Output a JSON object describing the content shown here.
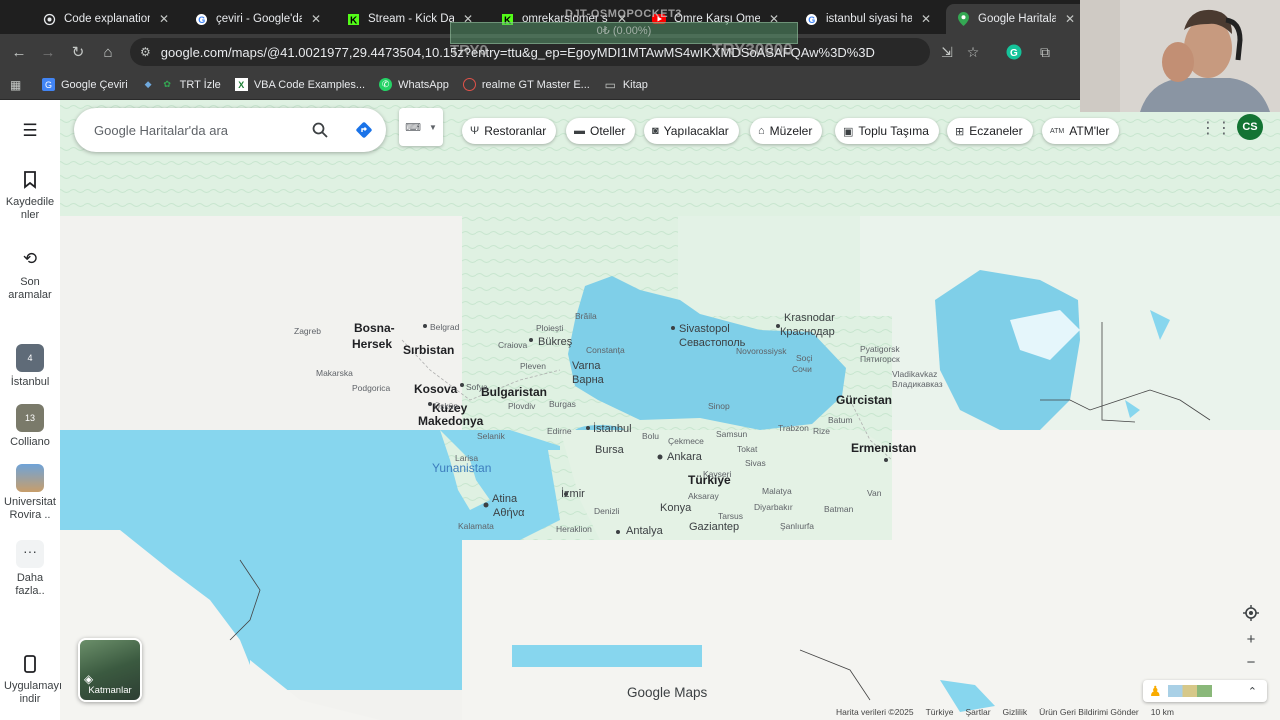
{
  "browser": {
    "tabs": [
      {
        "label": "Code explanation"
      },
      {
        "label": "çeviri - Google'da Ar"
      },
      {
        "label": "Stream - Kick Dashb"
      },
      {
        "label": "omrekarsiomer stre"
      },
      {
        "label": "Ömre Karşı Ömer - Y"
      },
      {
        "label": "istanbul siyasi harita"
      },
      {
        "label": "Google Haritalar"
      }
    ],
    "url": "google.com/maps/@41.0021977,29.4473504,10.15z?entry=ttu&g_ep=EgoyMDI1MTAwMS4wIKXMDSoASAFQAw%3D%3D",
    "bookmarks": [
      "Google Çeviri",
      "TRT İzle",
      "VBA Code Examples...",
      "WhatsApp",
      "realme GT Master E...",
      "Kitap"
    ]
  },
  "overlay": {
    "title": "DJT-OSMOPOCKET3",
    "progress": "0₺ (0.00%)",
    "left": "TRY0",
    "right": "TRY30000"
  },
  "maps": {
    "search_placeholder": "Google Haritalar'da ara",
    "chips": [
      "Restoranlar",
      "Oteller",
      "Yapılacaklar",
      "Müzeler",
      "Toplu Taşıma",
      "Eczaneler",
      "ATM'ler"
    ],
    "avatar": "CS",
    "rail": {
      "saved": "Kaydedilenler",
      "recent": "Son aramalar",
      "istanbul": "İstanbul",
      "colliano": "Colliano",
      "universitat": "Universitat Rovira ..",
      "more": "Daha fazla..",
      "app": "Uygulamayı indir"
    },
    "layers": "Katmanlar",
    "logo": "Google Maps",
    "footer": [
      "Harita verileri ©2025",
      "Türkiye",
      "Şartlar",
      "Gizlilik",
      "Ürün Geri Bildirimi Gönder",
      "10 km"
    ],
    "labels": {
      "bosna": "Bosna-",
      "hersek": "Hersek",
      "sirbistan": "Sırbistan",
      "kosova": "Kosova",
      "kuzey": "Kuzey",
      "makedonya": "Makedonya",
      "bulgaristan": "Bulgaristan",
      "yunanistan": "Yunanistan",
      "atina": "Atina",
      "atina_gr": "Αθήνα",
      "izmir": "İzmir",
      "bursa": "Bursa",
      "istanbul": "İstanbul",
      "ankara": "Ankara",
      "turkiye": "Türkiye",
      "konya": "Konya",
      "antalya": "Antalya",
      "gaziantep": "Gaziantep",
      "varna": "Varna",
      "varna_bg": "Варна",
      "bukres": "Bükreş",
      "sivastopol": "Sivastopol",
      "sivastopol_ru": "Севастополь",
      "krasnodar": "Krasnodar",
      "krasnodar_ru": "Краснодар",
      "gurcistan": "Gürcistan",
      "ermenistan": "Ermenistan",
      "belgrad": "Belgrad",
      "sofya": "Sofya",
      "uskup": "Üsküp",
      "podgorica": "Podgorica",
      "makarska": "Makarska",
      "ploiesti": "Ploiești",
      "craiova": "Craiova",
      "samsun": "Samsun",
      "sinop": "Sinop",
      "trabzon": "Trabzon",
      "rize": "Rize",
      "tokat": "Tokat",
      "sivas": "Sivas",
      "kayseri": "Kayseri",
      "malatya": "Malatya",
      "diyarbakir": "Diyarbakır",
      "batman": "Batman",
      "van": "Van",
      "soci": "Soçi",
      "sochi_ru": "Сочи",
      "pyatigorsk": "Pyatigorsk",
      "pyatigorsk_ru": "Пятигорск",
      "vladikavkaz": "Vladikavkaz",
      "vladikavkaz_ru": "Владикавказ",
      "bolu": "Bolu",
      "aksaray": "Aksaray",
      "denizli": "Denizli",
      "sanliurfa": "Şanlıurfa",
      "kalamata": "Kalamata",
      "heraklion": "Heraklion",
      "larisa": "Larisa",
      "edirne": "Edirne",
      "selanik": "Selanik",
      "cekmece": "Çekmece",
      "pleven": "Pleven",
      "zagreb": "Zagreb",
      "constanta": "Constanța",
      "burgas": "Burgas",
      "plovdiv": "Plovdiv",
      "batumi": "Batum",
      "novorossiysk": "Novorossiysk",
      "braila": "Brăila",
      "tarsus": "Tarsus"
    }
  }
}
